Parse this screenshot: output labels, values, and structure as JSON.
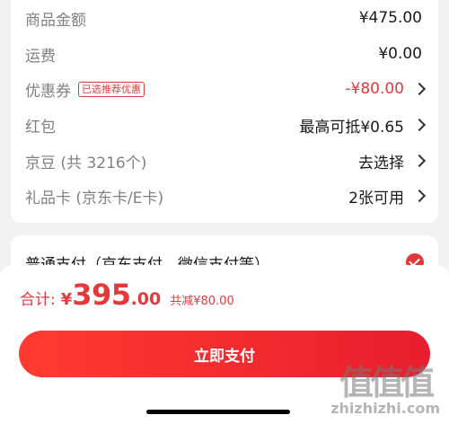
{
  "summary": {
    "rows": [
      {
        "label": "商品金额",
        "value": "¥475.00"
      },
      {
        "label": "运费",
        "value": "¥0.00"
      },
      {
        "label": "优惠券",
        "tag": "已选推荐优惠",
        "value": "-¥80.00"
      },
      {
        "label": "红包",
        "value": "最高可抵¥0.65"
      },
      {
        "label": "京豆 (共 3216个)",
        "value": "去选择"
      },
      {
        "label": "礼品卡 (京东卡/E卡)",
        "value": "2张可用"
      }
    ]
  },
  "payment": {
    "method_title": "普通支付（京东支付、微信支付等）"
  },
  "footer": {
    "total_label": "合计:",
    "currency": "¥",
    "total_integer": "395",
    "total_decimal": ".00",
    "saved_text": "共减¥80.00",
    "pay_button": "立即支付"
  },
  "watermark": {
    "logo_text": "值值值",
    "url": "zhizhizhi.com"
  },
  "colors": {
    "accent": "#e4393c",
    "background": "#f2f2f2"
  }
}
